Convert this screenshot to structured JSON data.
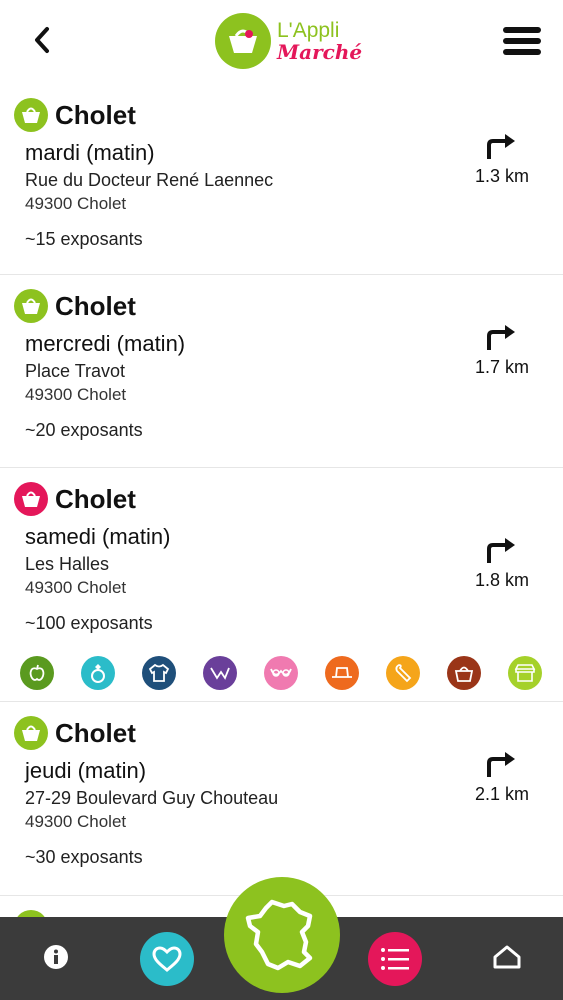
{
  "header": {
    "logo_line1": "L'Appli",
    "logo_line2": "Marché"
  },
  "markets": [
    {
      "town": "Cholet",
      "day": "mardi (matin)",
      "street": "Rue du Docteur René Laennec",
      "city": "49300 Cholet",
      "vendors": "~15 exposants",
      "distance": "1.3 km",
      "badge_color": "#8dc21f"
    },
    {
      "town": "Cholet",
      "day": "mercredi (matin)",
      "street": "Place Travot",
      "city": "49300 Cholet",
      "vendors": "~20 exposants",
      "distance": "1.7 km",
      "badge_color": "#8dc21f"
    },
    {
      "town": "Cholet",
      "day": "samedi (matin)",
      "street": "Les Halles",
      "city": "49300 Cholet",
      "vendors": "~100 exposants",
      "distance": "1.8 km",
      "badge_color": "#e4175a",
      "categories": [
        {
          "icon": "apple-icon",
          "color": "#5a9a1f"
        },
        {
          "icon": "ring-icon",
          "color": "#2bbcc9"
        },
        {
          "icon": "tshirt-icon",
          "color": "#1f4f7a"
        },
        {
          "icon": "clothing-icon",
          "color": "#6a3f9a"
        },
        {
          "icon": "lingerie-icon",
          "color": "#f07ab0"
        },
        {
          "icon": "hat-icon",
          "color": "#ee6a1e"
        },
        {
          "icon": "tools-icon",
          "color": "#f5a51a"
        },
        {
          "icon": "handbag-icon",
          "color": "#9a3518"
        },
        {
          "icon": "stall-icon",
          "color": "#a5d12a"
        }
      ]
    },
    {
      "town": "Cholet",
      "day": "jeudi (matin)",
      "street": "27-29 Boulevard Guy Chouteau",
      "city": "49300 Cholet",
      "vendors": "~30 exposants",
      "distance": "2.1 km",
      "badge_color": "#8dc21f"
    }
  ],
  "colors": {
    "brand_green": "#8dc21f",
    "brand_pink": "#e4175a",
    "favorites_teal": "#2bbcc9",
    "bottombar": "#3b3b3b"
  },
  "bottom_nav": [
    {
      "icon": "info-icon"
    },
    {
      "icon": "heart-icon"
    },
    {
      "icon": "france-map-icon"
    },
    {
      "icon": "list-icon"
    },
    {
      "icon": "home-icon"
    }
  ]
}
